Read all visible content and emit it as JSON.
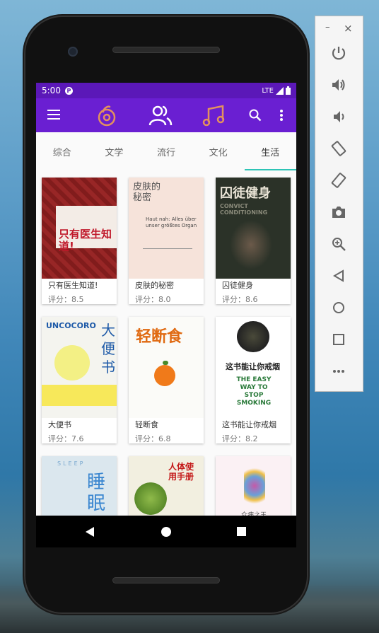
{
  "status": {
    "time": "5:00",
    "network": "LTE"
  },
  "appbar": {
    "icons": [
      "menu-icon",
      "music-circle-icon",
      "people-icon",
      "music-note-icon",
      "search-icon",
      "more-vert-icon"
    ]
  },
  "tabs": [
    {
      "label": "综合"
    },
    {
      "label": "文学"
    },
    {
      "label": "流行"
    },
    {
      "label": "文化"
    },
    {
      "label": "生活"
    }
  ],
  "active_tab": "生活",
  "books": [
    {
      "title": "只有医生知道!",
      "rating": "评分：8.5",
      "cover_text": "只有医生知道!",
      "cover_bg": "#8c1f1f"
    },
    {
      "title": "皮肤的秘密",
      "rating": "评分：8.0",
      "cover_text": "皮肤的秘密",
      "cover_bg": "#f6e3da"
    },
    {
      "title": "囚徒健身",
      "rating": "评分：8.6",
      "cover_text": "囚徒健身",
      "cover_bg": "#2b3228"
    },
    {
      "title": "大便书",
      "rating": "评分：7.6",
      "cover_text": "大便书",
      "cover_bg": "#f4f4ef"
    },
    {
      "title": "轻断食",
      "rating": "评分：6.8",
      "cover_text": "轻断食",
      "cover_bg": "#fbfbf8"
    },
    {
      "title": "这书能让你戒烟",
      "rating": "评分：8.2",
      "cover_text": "这书能让你戒烟",
      "cover_bg": "#ffffff"
    },
    {
      "title": "",
      "rating": "",
      "cover_text": "睡眠",
      "cover_bg": "#dbe7ee"
    },
    {
      "title": "",
      "rating": "",
      "cover_text": "人体使用手册",
      "cover_bg": "#f2efe0"
    },
    {
      "title": "",
      "rating": "",
      "cover_text": "众病之王",
      "cover_bg": "#fbf1f4"
    }
  ],
  "cover_english": {
    "cover1_sub": "Haut nah: Alles über unser größtes Organ",
    "cover2_sub": "CONVICT CONDITIONING",
    "cover3_sub": "UNCOCORO",
    "cover5_sub": "THE EASY WAY TO STOP SMOKING",
    "cover6_sub": "SLEEP"
  },
  "emulator": {
    "minimize": "–",
    "close": "×",
    "buttons": [
      "power-icon",
      "volume-up-icon",
      "volume-down-icon",
      "rotate-left-icon",
      "rotate-right-icon",
      "camera-icon",
      "zoom-in-icon",
      "back-icon",
      "home-icon",
      "overview-icon",
      "more-horiz-icon"
    ]
  },
  "colors": {
    "appbar": "#6a1fd2",
    "statusbar": "#5b18b8",
    "tab_indicator": "#2ec4b6",
    "accent_orange": "#e3915e"
  }
}
